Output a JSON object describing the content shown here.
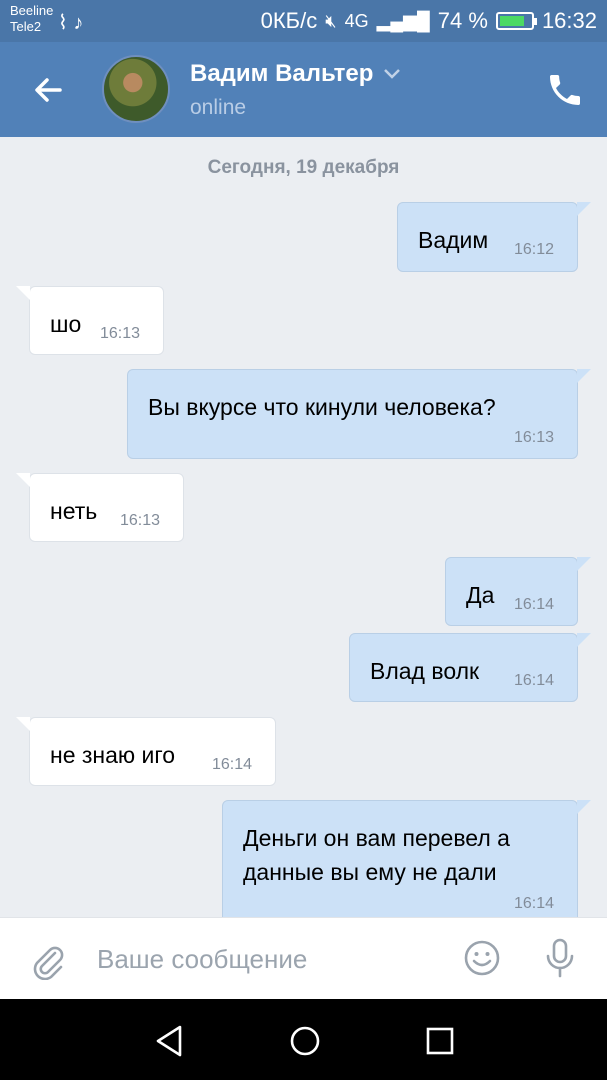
{
  "status_bar": {
    "carrier_1": "Beeline",
    "carrier_2": "Tele2",
    "data_speed": "0КБ/с",
    "network": "4G",
    "battery": "74 %",
    "time": "16:32"
  },
  "header": {
    "contact_name": "Вадим Вальтер",
    "status": "online"
  },
  "chat": {
    "date_separator": "Сегодня, 19 декабря",
    "messages": [
      {
        "direction": "out",
        "lines": [
          "Вадим"
        ],
        "time": "16:12"
      },
      {
        "direction": "in",
        "lines": [
          "шо"
        ],
        "time": "16:13"
      },
      {
        "direction": "out",
        "lines": [
          "Вы вкурсе что кинули человека?"
        ],
        "time": "16:13"
      },
      {
        "direction": "in",
        "lines": [
          "неть"
        ],
        "time": "16:13"
      },
      {
        "direction": "out",
        "lines": [
          "Да"
        ],
        "time": "16:14"
      },
      {
        "direction": "out",
        "lines": [
          "Влад волк"
        ],
        "time": "16:14"
      },
      {
        "direction": "in",
        "lines": [
          "не знаю иго"
        ],
        "time": "16:14"
      },
      {
        "direction": "out",
        "lines": [
          "Деньги он вам перевел а",
          "данные вы ему не дали"
        ],
        "time": "16:14"
      }
    ]
  },
  "input_bar": {
    "placeholder": "Ваше сообщение"
  },
  "icons": {
    "back": "arrow-left-icon",
    "call": "phone-icon",
    "attach": "paperclip-icon",
    "emoji": "smiley-icon",
    "mic": "microphone-icon"
  },
  "colors": {
    "header": "#5181b8",
    "status_bar": "#4a76a8",
    "chat_background": "#ebeef2",
    "outgoing_bubble": "#cce1f7",
    "incoming_bubble": "#ffffff"
  }
}
